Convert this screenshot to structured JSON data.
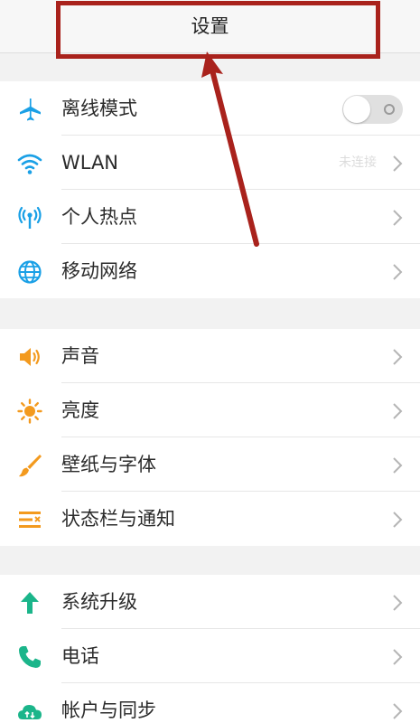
{
  "header": {
    "title": "设置"
  },
  "groups": [
    {
      "items": [
        {
          "label": "离线模式",
          "icon": "airplane-icon",
          "control": "toggle",
          "toggle_on": false
        },
        {
          "label": "WLAN",
          "icon": "wifi-icon",
          "control": "chevron",
          "value": "未连接"
        },
        {
          "label": "个人热点",
          "icon": "hotspot-icon",
          "control": "chevron"
        },
        {
          "label": "移动网络",
          "icon": "globe-icon",
          "control": "chevron"
        }
      ]
    },
    {
      "items": [
        {
          "label": "声音",
          "icon": "speaker-icon",
          "control": "chevron"
        },
        {
          "label": "亮度",
          "icon": "sun-icon",
          "control": "chevron"
        },
        {
          "label": "壁纸与字体",
          "icon": "brush-icon",
          "control": "chevron"
        },
        {
          "label": "状态栏与通知",
          "icon": "notification-list-icon",
          "control": "chevron"
        }
      ]
    },
    {
      "items": [
        {
          "label": "系统升级",
          "icon": "upgrade-arrow-icon",
          "control": "chevron"
        },
        {
          "label": "电话",
          "icon": "phone-icon",
          "control": "chevron"
        },
        {
          "label": "帐户与同步",
          "icon": "cloud-sync-icon",
          "control": "chevron"
        }
      ]
    }
  ],
  "colors": {
    "header_bg": "#f7f7f7",
    "page_bg": "#f2f2f2",
    "annotation_red": "#a9221c",
    "blue_icon": "#1aa0e6",
    "orange_icon": "#f39a1e",
    "green_icon": "#1bb58a"
  }
}
